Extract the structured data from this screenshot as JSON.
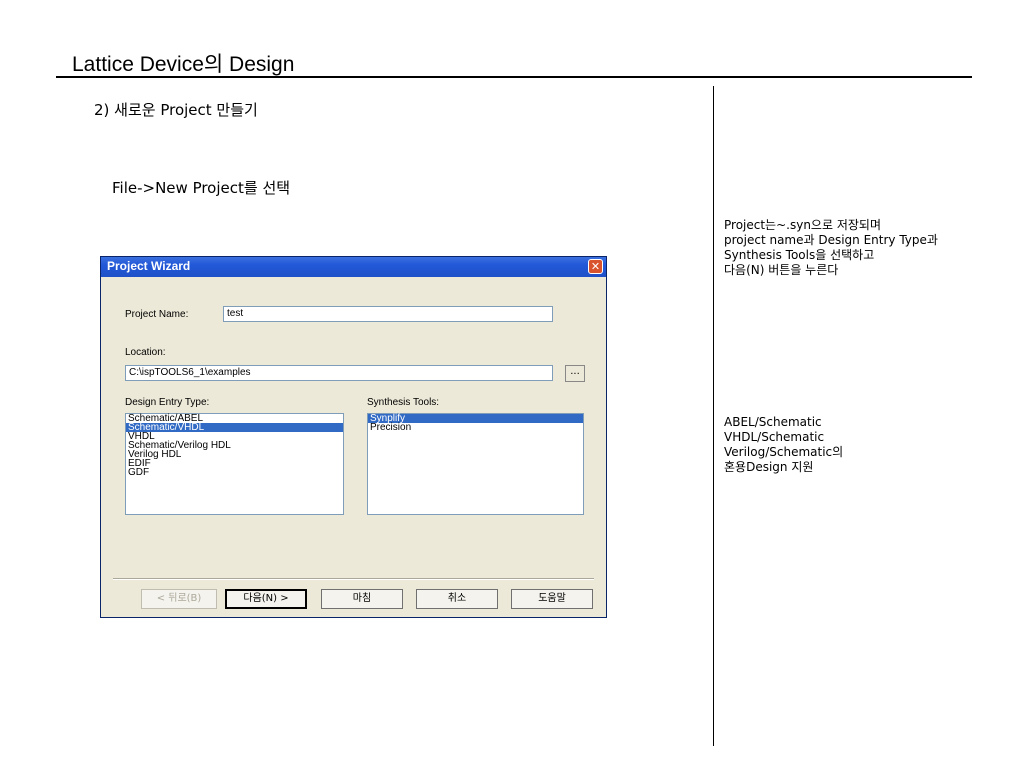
{
  "slide": {
    "title": "Lattice Device의 Design",
    "section_heading": "2) 새로운 Project 만들기",
    "instruction": "File->New Project를 선택"
  },
  "notes": {
    "note1": "Project는~.syn으로 저장되며\nproject name과 Design Entry Type과\nSynthesis Tools을 선택하고\n다음(N) 버튼을 누른다",
    "note2": "ABEL/Schematic\nVHDL/Schematic\nVerilog/Schematic의\n혼용Design 지원"
  },
  "dialog": {
    "title": "Project Wizard",
    "close_glyph": "✕",
    "project_name_label": "Project Name:",
    "project_name_value": "test",
    "location_label": "Location:",
    "location_value": "C:\\ispTOOLS6_1\\examples",
    "browse_label": "...",
    "design_entry_label": "Design Entry Type:",
    "design_entry_items": [
      "Schematic/ABEL",
      "Schematic/VHDL",
      "VHDL",
      "Schematic/Verilog HDL",
      "Verilog HDL",
      "EDIF",
      "GDF"
    ],
    "design_entry_selected": "Schematic/VHDL",
    "synthesis_label": "Synthesis Tools:",
    "synthesis_items": [
      "Synplify",
      "Precision"
    ],
    "synthesis_selected": "Synplify",
    "buttons": {
      "back": "< 뒤로(B)",
      "next": "다음(N) >",
      "finish": "마침",
      "cancel": "취소",
      "help": "도움말"
    }
  }
}
